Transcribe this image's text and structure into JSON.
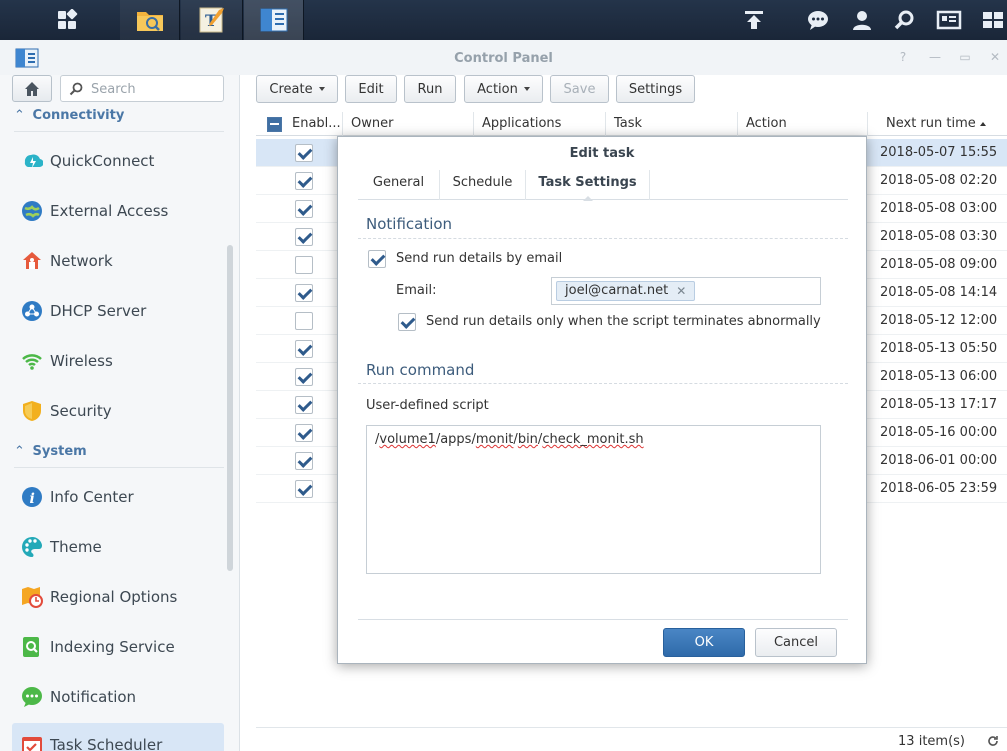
{
  "taskbar": {
    "icons": [
      "main-menu-icon",
      "file-station-icon",
      "text-editor-icon",
      "control-panel-icon",
      "upload-icon",
      "chat-icon",
      "user-icon",
      "search-icon",
      "widgets-icon",
      "pilot-view-icon"
    ]
  },
  "window": {
    "title": "Control Panel"
  },
  "sidebar": {
    "search_placeholder": "Search",
    "sections": [
      {
        "label": "Connectivity",
        "items": [
          {
            "label": "QuickConnect",
            "icon": "quickconnect-icon"
          },
          {
            "label": "External Access",
            "icon": "external-access-icon"
          },
          {
            "label": "Network",
            "icon": "network-icon"
          },
          {
            "label": "DHCP Server",
            "icon": "dhcp-server-icon"
          },
          {
            "label": "Wireless",
            "icon": "wireless-icon"
          },
          {
            "label": "Security",
            "icon": "security-icon"
          }
        ]
      },
      {
        "label": "System",
        "items": [
          {
            "label": "Info Center",
            "icon": "info-center-icon"
          },
          {
            "label": "Theme",
            "icon": "theme-icon"
          },
          {
            "label": "Regional Options",
            "icon": "regional-options-icon"
          },
          {
            "label": "Indexing Service",
            "icon": "indexing-service-icon"
          },
          {
            "label": "Notification",
            "icon": "notification-icon"
          },
          {
            "label": "Task Scheduler",
            "icon": "task-scheduler-icon",
            "active": true
          }
        ]
      }
    ]
  },
  "toolbar": {
    "create": "Create",
    "edit": "Edit",
    "run": "Run",
    "action": "Action",
    "save": "Save",
    "settings": "Settings"
  },
  "grid": {
    "columns": [
      "Enabl...",
      "Owner",
      "Applications",
      "Task",
      "Action",
      "Next run time"
    ],
    "rows": [
      {
        "enabled": true,
        "next_run": "2018-05-07 15:55",
        "selected": true
      },
      {
        "enabled": true,
        "next_run": "2018-05-08 02:20"
      },
      {
        "enabled": true,
        "next_run": "2018-05-08 03:00"
      },
      {
        "enabled": true,
        "next_run": "2018-05-08 03:30"
      },
      {
        "enabled": false,
        "next_run": "2018-05-08 09:00"
      },
      {
        "enabled": true,
        "next_run": "2018-05-08 14:14"
      },
      {
        "enabled": false,
        "next_run": "2018-05-12 12:00"
      },
      {
        "enabled": true,
        "next_run": "2018-05-13 05:50"
      },
      {
        "enabled": true,
        "next_run": "2018-05-13 06:00"
      },
      {
        "enabled": true,
        "next_run": "2018-05-13 17:17"
      },
      {
        "enabled": true,
        "next_run": "2018-05-16 00:00"
      },
      {
        "enabled": true,
        "next_run": "2018-06-01 00:00"
      },
      {
        "enabled": true,
        "next_run": "2018-06-05 23:59"
      }
    ],
    "item_count": "13 item(s)"
  },
  "dialog": {
    "title": "Edit task",
    "tabs": [
      "General",
      "Schedule",
      "Task Settings"
    ],
    "active_tab": "Task Settings",
    "notification": {
      "title": "Notification",
      "send_email_label": "Send run details by email",
      "send_email_checked": true,
      "email_label": "Email:",
      "email_value": "joel@carnat.net",
      "abnormal_label": "Send run details only when the script terminates abnormally",
      "abnormal_checked": true
    },
    "run_command": {
      "title": "Run command",
      "script_label": "User-defined script",
      "script_parts": [
        "/",
        "volume1",
        "/apps/",
        "monit",
        "/",
        "bin",
        "/",
        "check_monit.sh"
      ]
    },
    "ok_label": "OK",
    "cancel_label": "Cancel"
  },
  "colors": {
    "accent": "#2f6aaa",
    "selected_row": "#d8e6f6",
    "section_header": "#4a77a6"
  }
}
